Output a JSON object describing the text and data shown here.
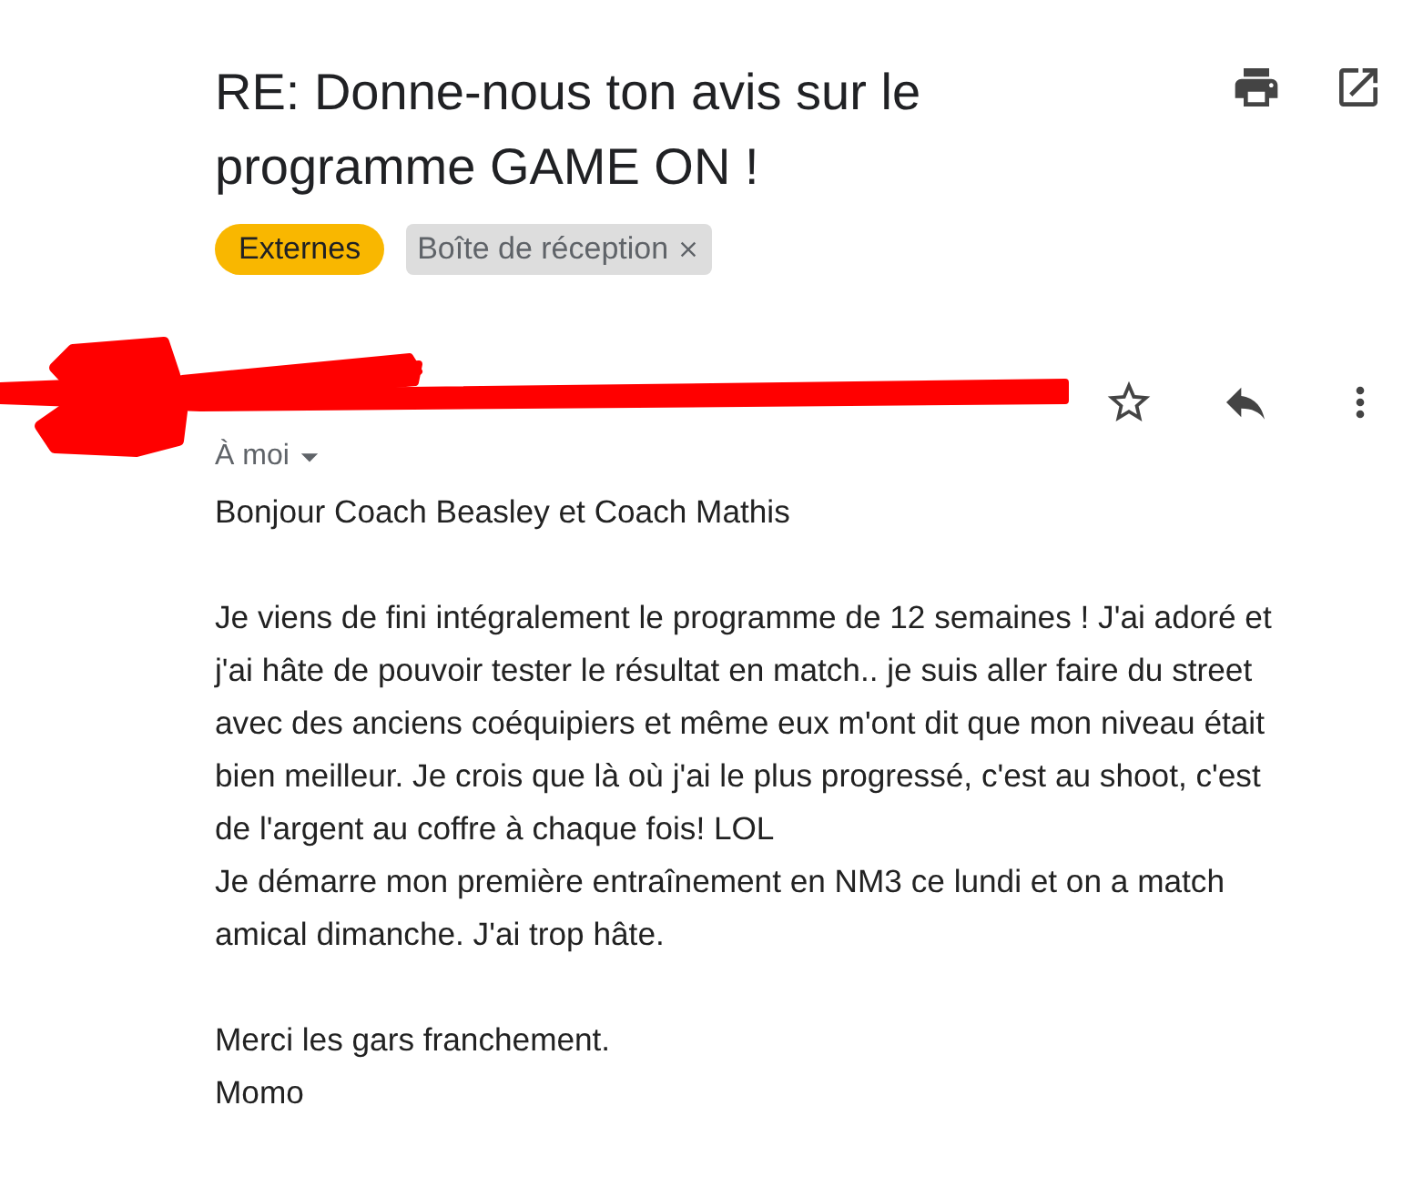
{
  "subject": "RE: Donne-nous ton avis sur le programme GAME ON !",
  "labels": [
    {
      "text": "Externes",
      "kind": "important",
      "removable": false
    },
    {
      "text": "Boîte de réception",
      "kind": "folder",
      "removable": true
    }
  ],
  "message": {
    "recipient": "À moi",
    "starred": false,
    "body": [
      [
        "Bonjour Coach Beasley et Coach Mathis"
      ],
      [
        "Je viens de fini intégralement le programme de 12 semaines ! J'ai adoré et",
        "j'ai hâte de pouvoir tester le résultat en match.. je suis aller faire du street",
        "avec des anciens coéquipiers et même eux m'ont dit que mon niveau était",
        "bien meilleur. Je crois que là où j'ai le plus progressé, c'est au shoot, c'est",
        "de l'argent au coffre à chaque fois! LOL",
        "Je démarre mon première entraînement en NM3 ce lundi et on a match",
        "amical dimanche. J'ai trop hâte."
      ],
      [
        "Merci les gars franchement.",
        "Momo"
      ]
    ]
  }
}
